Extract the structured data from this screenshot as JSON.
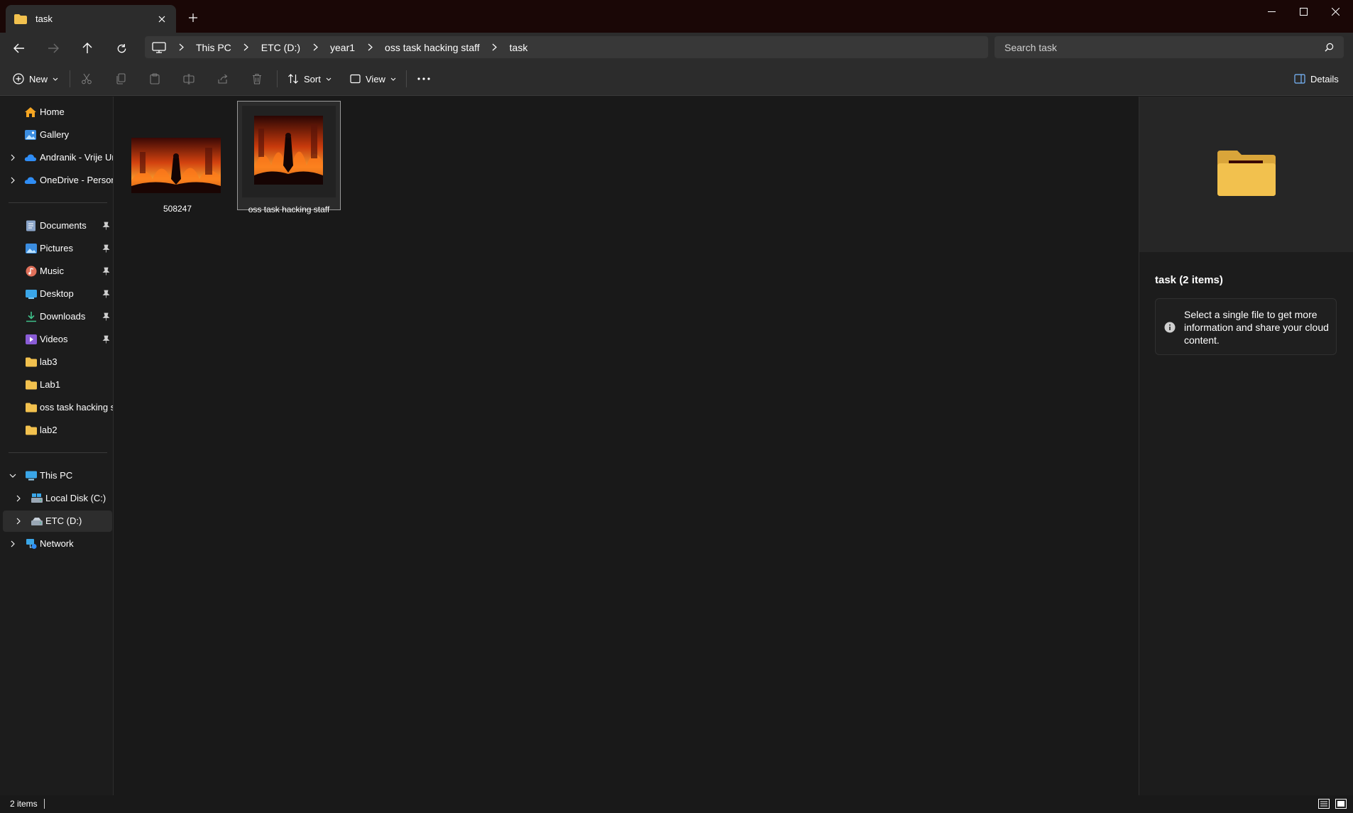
{
  "window": {
    "tab_title": "task",
    "controls": [
      "minimize-icon",
      "maximize-icon",
      "close-icon"
    ]
  },
  "address": {
    "root_icon": "this-pc-icon",
    "crumbs": [
      "This PC",
      "ETC (D:)",
      "year1",
      "oss task hacking staff",
      "task"
    ],
    "search_placeholder": "Search task"
  },
  "commands": {
    "new_label": "New",
    "sort_label": "Sort",
    "view_label": "View",
    "details_label": "Details",
    "disabled_icons": [
      "cut-icon",
      "copy-icon",
      "paste-icon",
      "rename-icon",
      "share-icon",
      "delete-icon"
    ]
  },
  "sidebar": {
    "top": [
      {
        "label": "Home",
        "icon": "home-icon"
      },
      {
        "label": "Gallery",
        "icon": "gallery-icon"
      },
      {
        "label": "Andranik - Vrije Universiteit",
        "icon": "cloud-icon"
      },
      {
        "label": "OneDrive - Personal",
        "icon": "cloud-icon"
      }
    ],
    "quick_access": [
      {
        "label": "Documents",
        "icon": "documents-icon",
        "pinned": true
      },
      {
        "label": "Pictures",
        "icon": "pictures-icon",
        "pinned": true
      },
      {
        "label": "Music",
        "icon": "music-icon",
        "pinned": true
      },
      {
        "label": "Desktop",
        "icon": "desktop-icon",
        "pinned": true
      },
      {
        "label": "Downloads",
        "icon": "downloads-icon",
        "pinned": true
      },
      {
        "label": "Videos",
        "icon": "videos-icon",
        "pinned": true
      },
      {
        "label": "lab3",
        "icon": "folder-icon",
        "pinned": false
      },
      {
        "label": "Lab1",
        "icon": "folder-icon",
        "pinned": false
      },
      {
        "label": "oss task hacking staff",
        "icon": "folder-icon",
        "pinned": false
      },
      {
        "label": "lab2",
        "icon": "folder-icon",
        "pinned": false
      }
    ],
    "this_pc": [
      {
        "label": "This PC",
        "icon": "this-pc-icon"
      },
      {
        "label": "Local Disk (C:)",
        "icon": "drive-icon"
      },
      {
        "label": "ETC (D:)",
        "icon": "drive-icon"
      },
      {
        "label": "Network",
        "icon": "network-icon"
      }
    ]
  },
  "files": [
    {
      "name": "508247",
      "type": "image",
      "selected": false
    },
    {
      "name": "oss task hacking staff",
      "type": "image",
      "selected": true
    }
  ],
  "details": {
    "title": "task (2 items)",
    "info": "Select a single file to get more information and share your cloud content."
  },
  "status": {
    "item_count": "2 items"
  },
  "colors": {
    "titlebar": "#1a0706",
    "toolbar": "#2c2c2c",
    "background": "#191919",
    "folder": "#f2c14e"
  }
}
